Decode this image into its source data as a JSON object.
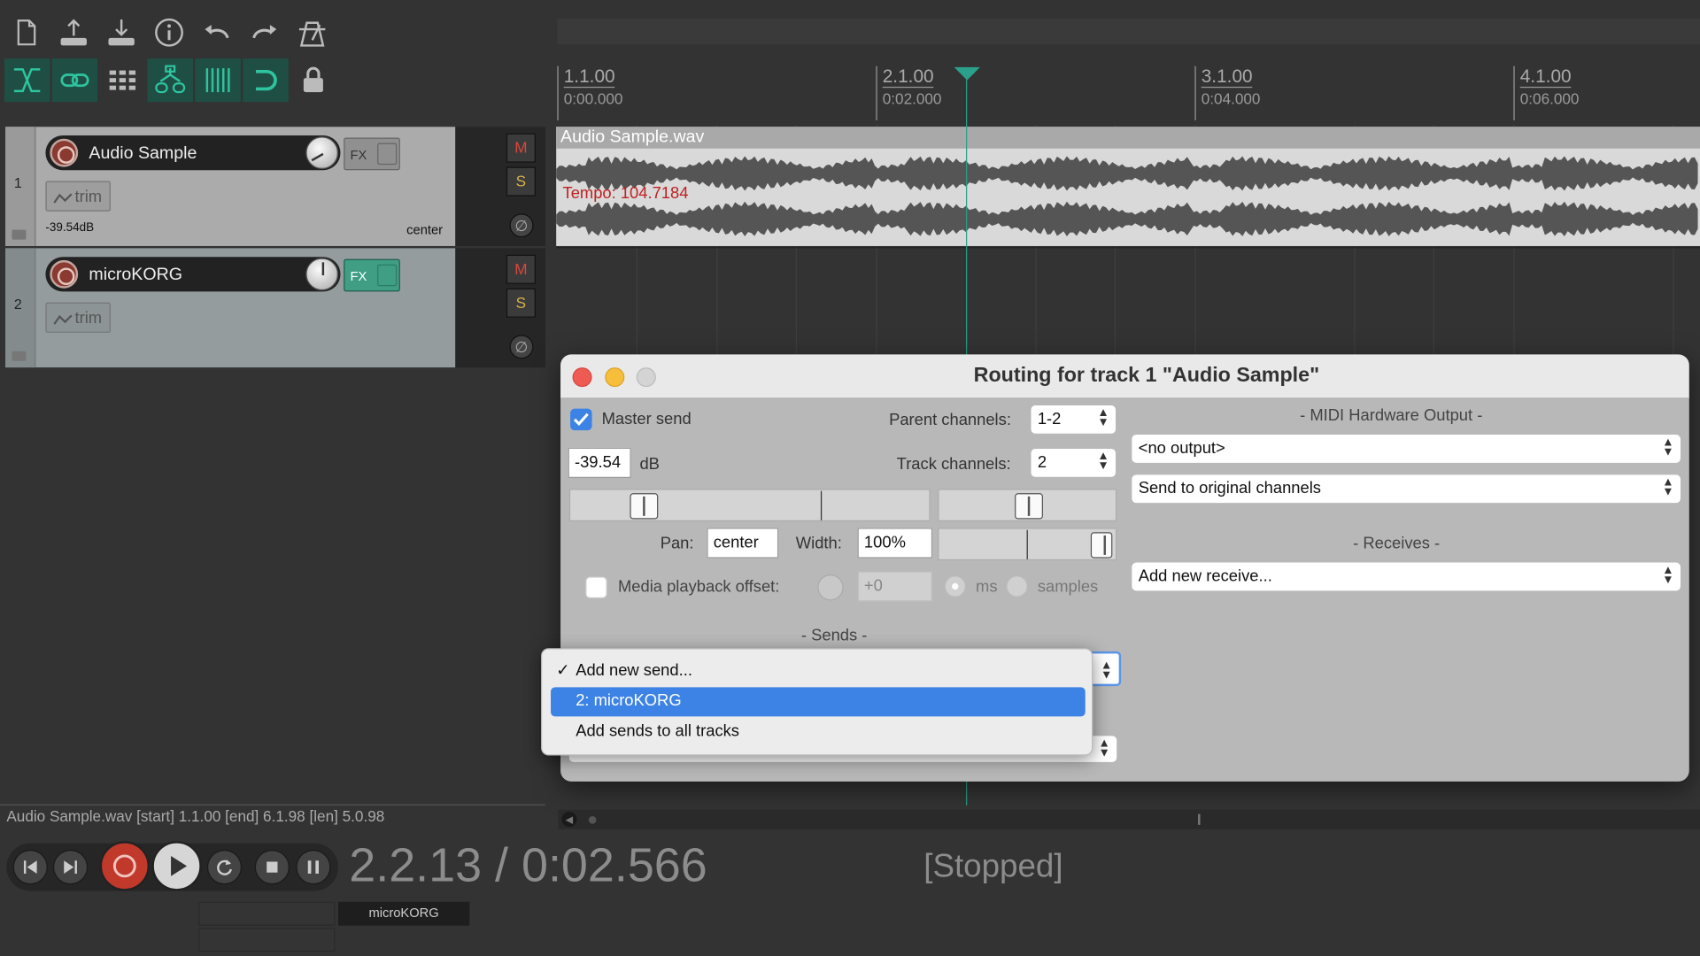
{
  "toolbar": {
    "row1_icons": [
      "new-project-icon",
      "save-icon",
      "open-icon",
      "info-icon",
      "undo-icon",
      "redo-icon",
      "metronome-icon"
    ],
    "row2_icons": [
      "ripple-edit-icon",
      "link-icon",
      "grid-icon",
      "group-icon",
      "snap-grid-icon",
      "loop-icon",
      "lock-icon"
    ]
  },
  "tracks": [
    {
      "number": "1",
      "name": "Audio Sample",
      "fx_label": "FX",
      "trim_label": "trim",
      "volume": "-39.54dB",
      "pan": "center",
      "fx_active": false
    },
    {
      "number": "2",
      "name": "microKORG",
      "fx_label": "FX",
      "trim_label": "trim",
      "volume": "",
      "pan": "",
      "fx_active": true
    }
  ],
  "track_controls": {
    "mute": "M",
    "solo": "S",
    "phase": "∅"
  },
  "ruler": [
    {
      "bar": "1.1.00",
      "time": "0:00.000"
    },
    {
      "bar": "2.1.00",
      "time": "0:02.000"
    },
    {
      "bar": "3.1.00",
      "time": "0:04.000"
    },
    {
      "bar": "4.1.00",
      "time": "0:06.000"
    }
  ],
  "media_item": {
    "title": "Audio Sample.wav",
    "tempo": "Tempo: 104.7184"
  },
  "routing_dialog": {
    "title": "Routing for track 1 \"Audio Sample\"",
    "master_send_label": "Master send",
    "master_send_checked": true,
    "parent_channels_label": "Parent channels:",
    "parent_channels_value": "1-2",
    "track_channels_label": "Track channels:",
    "track_channels_value": "2",
    "volume_value": "-39.54",
    "volume_unit": "dB",
    "pan_label": "Pan:",
    "pan_value": "center",
    "width_label": "Width:",
    "width_value": "100%",
    "media_offset_label": "Media playback offset:",
    "media_offset_value": "+0",
    "ms_label": "ms",
    "samples_label": "samples",
    "sends_header": "-  Sends  -",
    "midi_hw_header": "-  MIDI Hardware Output  -",
    "midi_output_value": "<no output>",
    "midi_channels_value": "Send to original channels",
    "receives_header": "-  Receives  -",
    "add_receive_value": "Add new receive..."
  },
  "send_menu": {
    "items": [
      {
        "label": "Add new send...",
        "checked": true,
        "highlighted": false
      },
      {
        "label": "2: microKORG",
        "checked": false,
        "highlighted": true
      },
      {
        "label": "Add sends to all tracks",
        "checked": false,
        "highlighted": false
      }
    ]
  },
  "status_bar": "Audio Sample.wav [start] 1.1.00 [end] 6.1.98 [len] 5.0.98",
  "transport": {
    "position": "2.2.13 / 0:02.566",
    "state": "[Stopped]"
  },
  "mixer_label": "microKORG",
  "colors": {
    "accent": "#2ba08a",
    "record": "#c0392b",
    "highlight": "#3d83e6",
    "tempo": "#c02020"
  }
}
